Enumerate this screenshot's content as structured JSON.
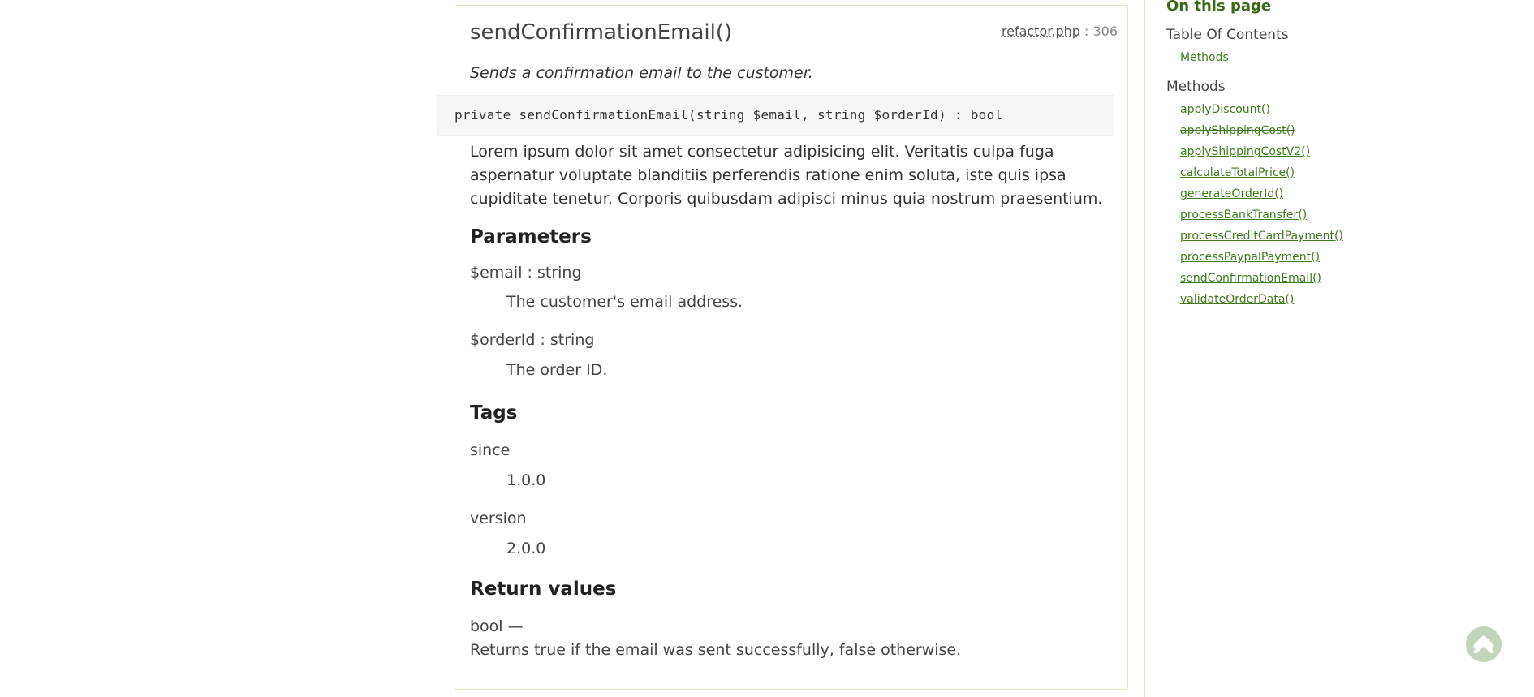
{
  "method": {
    "title": "sendConfirmationEmail()",
    "source_file": "refactor.php",
    "source_separator": " : ",
    "source_line": "306",
    "summary": "Sends a confirmation email to the customer.",
    "signature": "private sendConfirmationEmail(string $email, string $orderId) : bool",
    "description": "Lorem ipsum dolor sit amet consectetur adipisicing elit. Veritatis culpa fuga aspernatur voluptate blanditiis perferendis ratione enim soluta, iste quis ipsa cupiditate tenetur. Corporis quibusdam adipisci minus quia nostrum praesentium.",
    "parameters_heading": "Parameters",
    "parameters": [
      {
        "term": "$email : string",
        "definition": "The customer's email address."
      },
      {
        "term": "$orderId : string",
        "definition": "The order ID."
      }
    ],
    "tags_heading": "Tags",
    "tags": [
      {
        "term": "since",
        "definition": "1.0.0"
      },
      {
        "term": "version",
        "definition": "2.0.0"
      }
    ],
    "return_heading": "Return values",
    "return_type": "bool —",
    "return_description": "Returns true if the email was sent successfully, false otherwise."
  },
  "sidebar": {
    "heading": "On this page",
    "toc_label": "Table Of Contents",
    "toc_links": [
      "Methods"
    ],
    "methods_label": "Methods",
    "methods": [
      {
        "label": "applyDiscount()",
        "deprecated": false
      },
      {
        "label": "applyShippingCost()",
        "deprecated": true
      },
      {
        "label": "applyShippingCostV2()",
        "deprecated": false
      },
      {
        "label": "calculateTotalPrice()",
        "deprecated": false
      },
      {
        "label": "generateOrderId()",
        "deprecated": false
      },
      {
        "label": "processBankTransfer()",
        "deprecated": false
      },
      {
        "label": "processCreditCardPayment()",
        "deprecated": false
      },
      {
        "label": "processPaypalPayment()",
        "deprecated": false
      },
      {
        "label": "sendConfirmationEmail()",
        "deprecated": false
      },
      {
        "label": "validateOrderData()",
        "deprecated": false
      }
    ]
  },
  "back_to_top": {
    "icon": "chevron-up-icon"
  },
  "colors": {
    "accent": "#3f7a1c",
    "border": "#dde8c8",
    "code_bg": "#f7f7f7",
    "back_to_top_bg": "#c5d5bd"
  }
}
